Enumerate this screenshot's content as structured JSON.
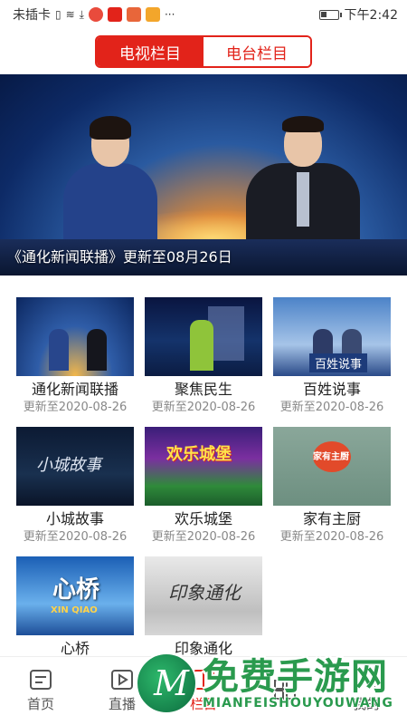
{
  "status_bar": {
    "carrier": "未插卡",
    "time": "下午2:42",
    "icons": [
      "sim-icon",
      "wifi-icon",
      "download-icon",
      "app-icon",
      "app-icon",
      "app-icon",
      "more-dots-icon",
      "battery-icon"
    ]
  },
  "tabs": [
    {
      "label": "电视栏目",
      "active": true
    },
    {
      "label": "电台栏目",
      "active": false
    }
  ],
  "banner": {
    "caption": "《通化新闻联播》更新至08月26日"
  },
  "programs": [
    {
      "title": "通化新闻联播",
      "date": "更新至2020-08-26"
    },
    {
      "title": "聚焦民生",
      "date": "更新至2020-08-26"
    },
    {
      "title": "百姓说事",
      "date": "更新至2020-08-26"
    },
    {
      "title": "小城故事",
      "date": "更新至2020-08-26"
    },
    {
      "title": "欢乐城堡",
      "date": "更新至2020-08-26"
    },
    {
      "title": "家有主厨",
      "date": "更新至2020-08-26"
    },
    {
      "title": "心桥",
      "date": ""
    },
    {
      "title": "印象通化",
      "date": ""
    }
  ],
  "thumb_text": {
    "t3": "百姓说事",
    "t4": "小城故事",
    "t5": "欢乐城堡",
    "t6": "家有主厨",
    "t7": "心桥",
    "t7_sub": "XIN QIAO",
    "t8": "印象通化"
  },
  "bottom_nav": [
    {
      "label": "首页",
      "icon": "news-icon"
    },
    {
      "label": "直播",
      "icon": "video-icon"
    },
    {
      "label": "栏目",
      "icon": "columns-icon"
    },
    {
      "label": "",
      "icon": "grid-icon"
    },
    {
      "label": "我的",
      "icon": "user-icon"
    }
  ],
  "watermark": {
    "title": "免费手游网",
    "subtitle": "MIANFEISHOUYOUWANG"
  }
}
